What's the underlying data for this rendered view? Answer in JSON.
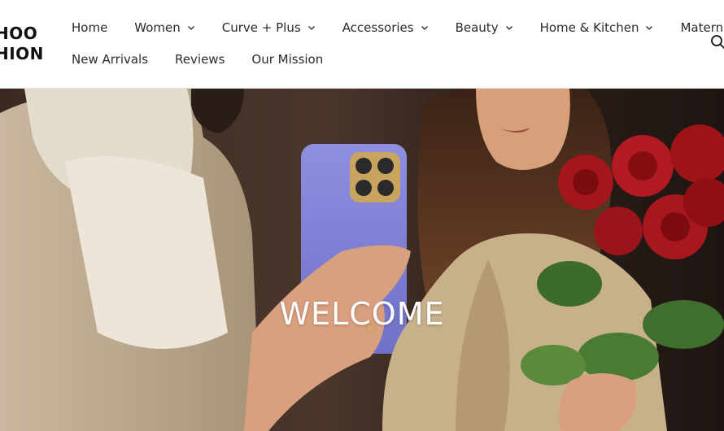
{
  "brand": {
    "logo_line1": "HOO",
    "logo_line2": "HION"
  },
  "nav": {
    "row1": [
      {
        "label": "Home",
        "dropdown": false
      },
      {
        "label": "Women",
        "dropdown": true
      },
      {
        "label": "Curve + Plus",
        "dropdown": true
      },
      {
        "label": "Accessories",
        "dropdown": true
      },
      {
        "label": "Beauty",
        "dropdown": true
      },
      {
        "label": "Home & Kitchen",
        "dropdown": true
      },
      {
        "label": "Maternity",
        "dropdown": false
      }
    ],
    "row2": [
      {
        "label": "New Arrivals"
      },
      {
        "label": "Reviews"
      },
      {
        "label": "Our Mission"
      }
    ]
  },
  "icons": {
    "search": "search-icon",
    "chevron": "chevron-down-icon"
  },
  "hero": {
    "heading": "WELCOME"
  },
  "colors": {
    "text": "#2a2a2a",
    "hero_text": "#ffffff",
    "border": "#e3e3e3"
  }
}
